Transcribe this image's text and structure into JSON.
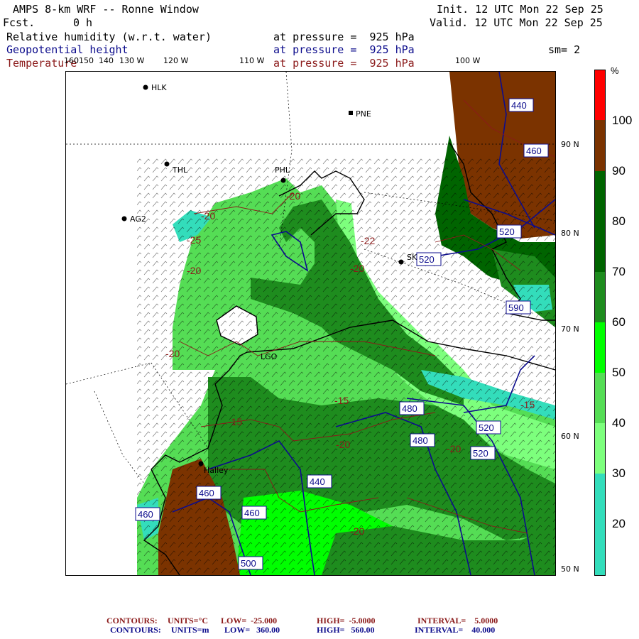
{
  "header": {
    "title": "AMPS 8-km WRF -- Ronne Window",
    "forecast_label": "Fcst.",
    "forecast_value": "0 h",
    "init": "Init. 12 UTC Mon 22 Sep 25",
    "valid": "Valid. 12 UTC Mon 22 Sep 25",
    "smoothing": "sm= 2"
  },
  "fields": [
    {
      "name": "Relative humidity (w.r.t. water)",
      "level": "at pressure =  925 hPa",
      "color": "#000000"
    },
    {
      "name": "Geopotential height",
      "level": "at pressure =  925 hPa",
      "color": "#0c0c8c"
    },
    {
      "name": "Temperature",
      "level": "at pressure =  925 hPa",
      "color": "#8b1a1a"
    }
  ],
  "longitude_labels": [
    "160",
    "150",
    "140",
    "130 W",
    "120 W",
    "110 W",
    "100 W"
  ],
  "latitude_labels": [
    "90 N",
    "80 N",
    "70 N",
    "60 N",
    "50 N"
  ],
  "stations": [
    "HLK",
    "PNE",
    "THL",
    "PHL",
    "AG2",
    "SKI",
    "LGO",
    "Halley"
  ],
  "height_contour_labels": [
    "440",
    "460",
    "520",
    "520",
    "590",
    "480",
    "480",
    "520",
    "520",
    "440",
    "460",
    "460",
    "460",
    "500"
  ],
  "temperature_contour_labels": [
    "-20",
    "-20",
    "-25",
    "-20",
    "-20",
    "-22",
    "-20",
    "-15",
    "-15",
    "-15",
    "-20",
    "-20",
    "-20"
  ],
  "colorbar": {
    "unit": "%",
    "ticks": [
      "100",
      "90",
      "80",
      "70",
      "60",
      "50",
      "40",
      "30",
      "20"
    ],
    "colors": [
      "#ff0000",
      "#7b3300",
      "#006400",
      "#1e8c1e",
      "#00ff00",
      "#55dd55",
      "#7dff7d",
      "#33ddbb",
      "#ffffff"
    ]
  },
  "footer": {
    "temp_line": {
      "label": "CONTOURS:",
      "units": "UNITS=°C",
      "low": "LOW=  -25.000",
      "high": "HIGH=  -5.0000",
      "interval": "INTERVAL=    5.0000"
    },
    "height_line": {
      "label": "CONTOURS:",
      "units": "UNITS=m",
      "low": "LOW=   360.00",
      "high": "HIGH=   560.00",
      "interval": "INTERVAL=    40.000"
    }
  }
}
